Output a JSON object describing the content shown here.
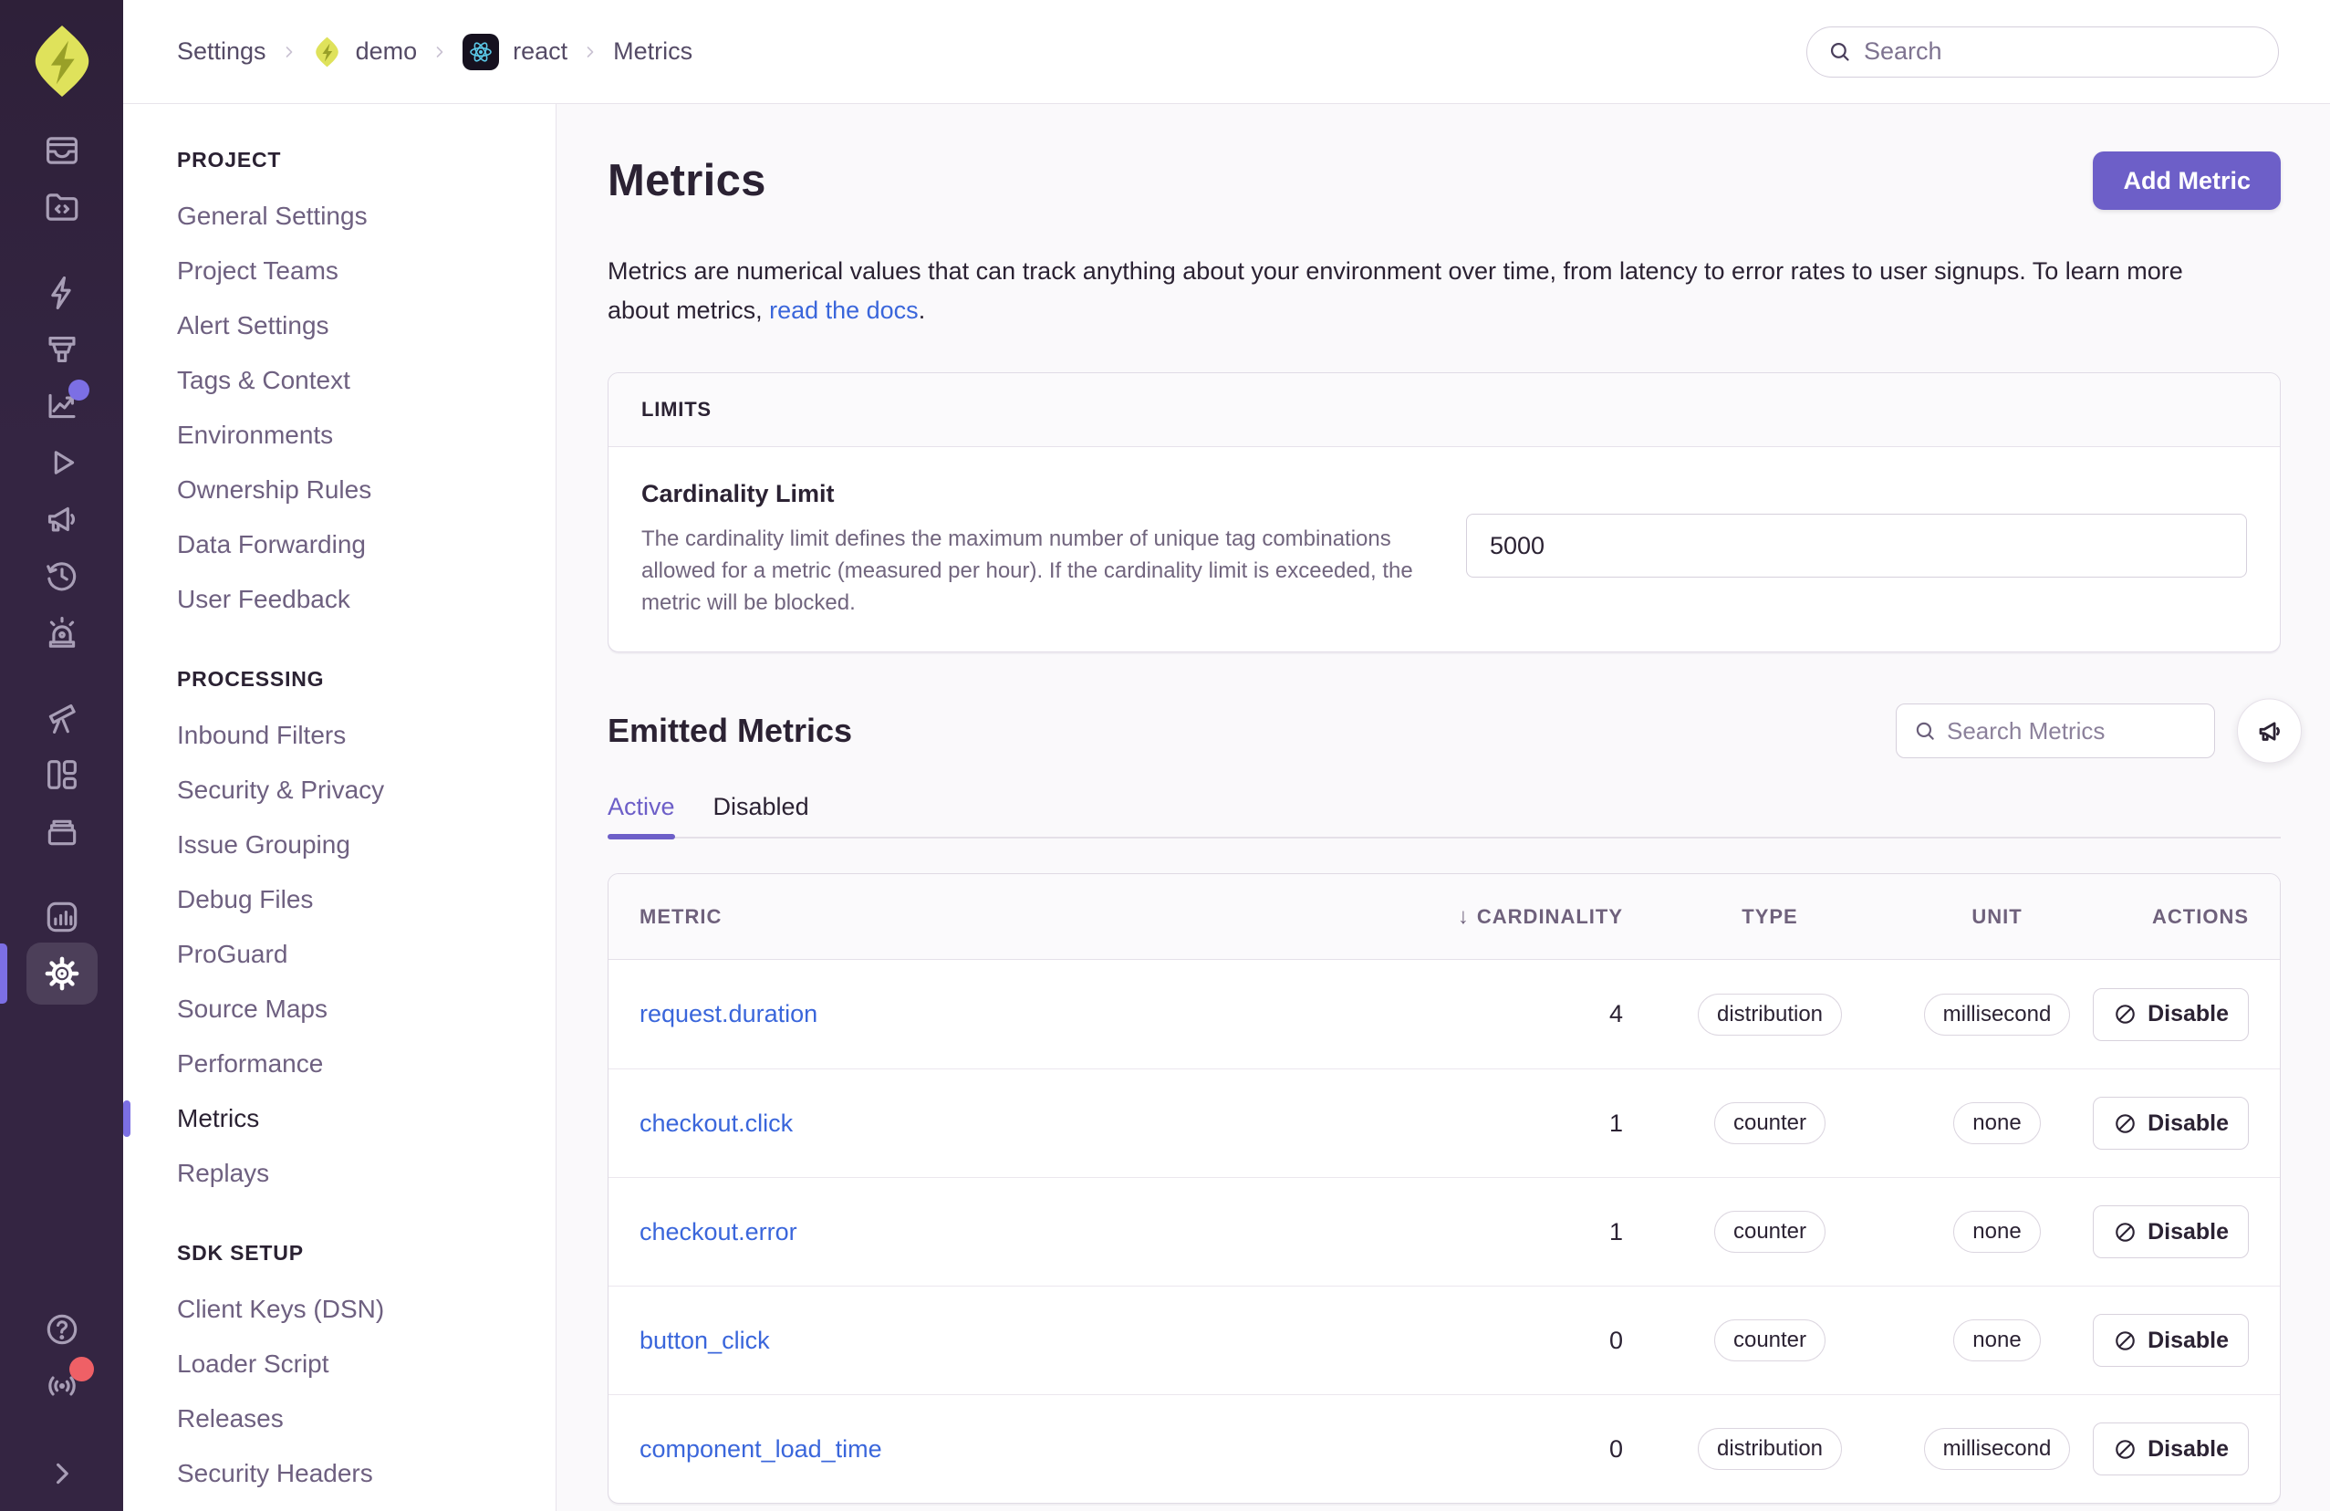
{
  "colors": {
    "accent": "#6D5FC8",
    "indicator": "#7C6FE4",
    "link": "#3A66DB",
    "rail-bg": "#342542",
    "rail-icon": "#A89EB6",
    "text": "#2B2233",
    "text-light": "#71657E",
    "border": "#E0DBE6",
    "page-bg": "#FAF9FB",
    "red": "#EF6066",
    "header-bg": "#FBFAFC",
    "logo-lime": "#DFE25B",
    "react-cyan": "#5BC9E8"
  },
  "topbar": {
    "breadcrumbs": [
      {
        "label": "Settings"
      },
      {
        "label": "demo",
        "icon": "sentry"
      },
      {
        "label": "react",
        "icon": "react"
      },
      {
        "label": "Metrics"
      }
    ],
    "search_placeholder": "Search"
  },
  "rail": {
    "groups": [
      {
        "items": [
          {
            "name": "issues"
          },
          {
            "name": "projects"
          }
        ]
      },
      {
        "items": [
          {
            "name": "quickstart"
          },
          {
            "name": "ingest-funnel"
          },
          {
            "name": "graph",
            "badge": "purple"
          },
          {
            "name": "replays"
          },
          {
            "name": "feedback"
          },
          {
            "name": "releases"
          },
          {
            "name": "alerts"
          }
        ]
      },
      {
        "items": [
          {
            "name": "discover"
          },
          {
            "name": "dashboards"
          },
          {
            "name": "archive"
          }
        ]
      },
      {
        "items": [
          {
            "name": "stats"
          },
          {
            "name": "settings",
            "active": true
          }
        ]
      }
    ],
    "bottom": [
      {
        "name": "help"
      },
      {
        "name": "broadcast",
        "badge": "red"
      },
      {
        "name": "collapse"
      }
    ]
  },
  "settings_nav": {
    "sections": [
      {
        "title": "PROJECT",
        "items": [
          {
            "label": "General Settings"
          },
          {
            "label": "Project Teams"
          },
          {
            "label": "Alert Settings"
          },
          {
            "label": "Tags & Context"
          },
          {
            "label": "Environments"
          },
          {
            "label": "Ownership Rules"
          },
          {
            "label": "Data Forwarding"
          },
          {
            "label": "User Feedback"
          }
        ]
      },
      {
        "title": "PROCESSING",
        "items": [
          {
            "label": "Inbound Filters"
          },
          {
            "label": "Security & Privacy"
          },
          {
            "label": "Issue Grouping"
          },
          {
            "label": "Debug Files"
          },
          {
            "label": "ProGuard"
          },
          {
            "label": "Source Maps"
          },
          {
            "label": "Performance"
          },
          {
            "label": "Metrics",
            "active": true
          },
          {
            "label": "Replays"
          }
        ]
      },
      {
        "title": "SDK SETUP",
        "items": [
          {
            "label": "Client Keys (DSN)"
          },
          {
            "label": "Loader Script"
          },
          {
            "label": "Releases"
          },
          {
            "label": "Security Headers"
          }
        ]
      }
    ]
  },
  "main": {
    "title": "Metrics",
    "add_button": "Add Metric",
    "description_before": "Metrics are numerical values that can track anything about your environment over time, from latency to error rates to user signups. To learn more about metrics, ",
    "docs_link": "read the docs",
    "description_after": ".",
    "limits": {
      "header": "LIMITS",
      "field_label": "Cardinality Limit",
      "field_help": "The cardinality limit defines the maximum number of unique tag combinations allowed for a metric (measured per hour). If the cardinality limit is exceeded, the metric will be blocked.",
      "input_value": "5000"
    },
    "emitted": {
      "title": "Emitted Metrics",
      "search_placeholder": "Search Metrics",
      "tabs": [
        {
          "label": "Active",
          "active": true
        },
        {
          "label": "Disabled",
          "active": false
        }
      ],
      "table": {
        "headers": [
          {
            "label": "METRIC"
          },
          {
            "label": "CARDINALITY",
            "sorted": true,
            "align": "right"
          },
          {
            "label": "TYPE",
            "align": "center"
          },
          {
            "label": "UNIT",
            "align": "center"
          },
          {
            "label": "ACTIONS",
            "align": "right"
          }
        ],
        "rows": [
          {
            "metric": "request.duration",
            "cardinality": "4",
            "type": "distribution",
            "unit": "millisecond",
            "action": "Disable"
          },
          {
            "metric": "checkout.click",
            "cardinality": "1",
            "type": "counter",
            "unit": "none",
            "action": "Disable"
          },
          {
            "metric": "checkout.error",
            "cardinality": "1",
            "type": "counter",
            "unit": "none",
            "action": "Disable"
          },
          {
            "metric": "button_click",
            "cardinality": "0",
            "type": "counter",
            "unit": "none",
            "action": "Disable"
          },
          {
            "metric": "component_load_time",
            "cardinality": "0",
            "type": "distribution",
            "unit": "millisecond",
            "action": "Disable"
          }
        ]
      }
    }
  }
}
